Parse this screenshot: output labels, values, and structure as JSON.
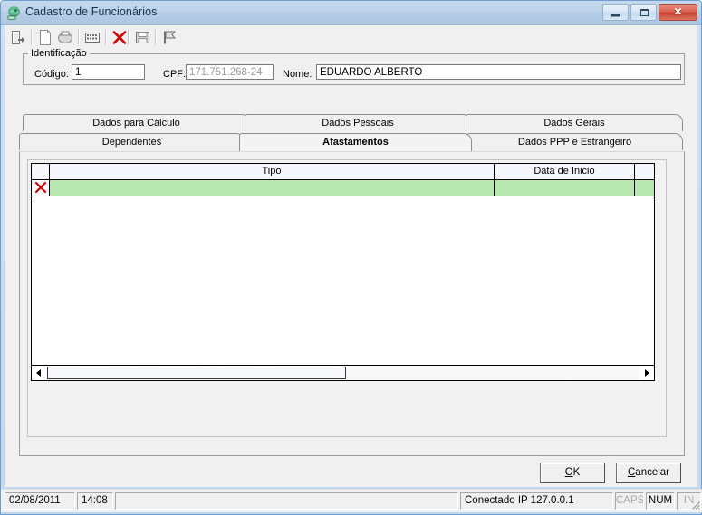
{
  "window": {
    "title": "Cadastro de Funcionários",
    "icon": "app-user-icon",
    "caption_buttons": [
      {
        "name": "minimize-button",
        "glyph": "minimize"
      },
      {
        "name": "maximize-button",
        "glyph": "maximize"
      },
      {
        "name": "close-button",
        "glyph": "✕"
      }
    ]
  },
  "toolbar": {
    "buttons": [
      {
        "name": "exit-icon",
        "title": "Sair"
      },
      {
        "name": "new-document-icon",
        "title": "Novo"
      },
      {
        "name": "print-icon",
        "title": "Imprimir"
      },
      {
        "name": "grid-list-icon",
        "title": "Listar"
      },
      {
        "name": "delete-icon",
        "title": "Excluir"
      },
      {
        "name": "save-icon",
        "title": "Gravar"
      },
      {
        "name": "flag-icon",
        "title": "Marcar"
      }
    ]
  },
  "identification": {
    "group_label": "Identificação",
    "codigo": {
      "label": "Código:",
      "value": "1"
    },
    "cpf": {
      "label": "CPF:",
      "value": "171.751.268-24"
    },
    "nome": {
      "label": "Nome:",
      "value": "EDUARDO ALBERTO"
    }
  },
  "tabs": {
    "row1": [
      {
        "label": "Dados para Cálculo",
        "active": false
      },
      {
        "label": "Dados Pessoais",
        "active": false
      },
      {
        "label": "Dados Gerais",
        "active": false
      }
    ],
    "row2": [
      {
        "label": "Dependentes",
        "active": false
      },
      {
        "label": "Afastamentos",
        "active": true
      },
      {
        "label": "Dados PPP e Estrangeiro",
        "active": false
      }
    ]
  },
  "grid": {
    "columns": [
      "",
      "Tipo",
      "Data de Inicio",
      ""
    ],
    "rows": [
      {
        "indicator": "red-x-icon",
        "tipo": "",
        "data_de_inicio": "",
        "extra": "",
        "selected": true
      }
    ],
    "row_color": "#b7e6b0",
    "header_color": "#f6f7fc"
  },
  "dialog_buttons": {
    "ok": {
      "accel": "O",
      "rest": "K"
    },
    "cancel": {
      "accel": "C",
      "rest": "ancelar"
    }
  },
  "statusbar": {
    "date": "02/08/2011",
    "time": "14:08",
    "message": "",
    "connection": "Conectado IP 127.0.0.1",
    "caps": "CAPS",
    "num": "NUM",
    "ins": "IN"
  }
}
